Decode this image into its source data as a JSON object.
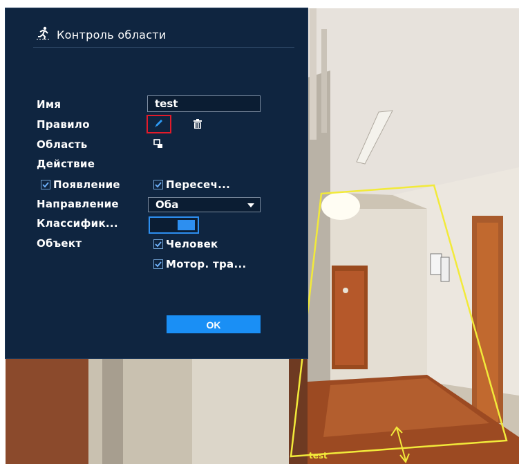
{
  "dialog": {
    "title": "Контроль области",
    "name_label": "Имя",
    "name_value": "test",
    "rule_label": "Правило",
    "area_label": "Область",
    "action_label": "Действие",
    "actions": [
      {
        "label": "Появление",
        "checked": true
      },
      {
        "label": "Пересеч...",
        "checked": true
      }
    ],
    "direction_label": "Направление",
    "direction_value": "Оба",
    "classification_label": "Классифик...",
    "classification_on": true,
    "object_label": "Объект",
    "objects": [
      {
        "label": "Человек",
        "checked": true
      },
      {
        "label": "Мотор. тра...",
        "checked": true
      }
    ],
    "ok_label": "OK"
  },
  "icons": {
    "title": "running-person-icon",
    "rule_edit": "pencil-icon",
    "rule_delete": "trash-icon",
    "area": "area-draw-icon"
  },
  "video": {
    "zone_label": "test"
  },
  "colors": {
    "dialog_bg": "#0f2540",
    "accent": "#1a8ff5",
    "highlight_border": "#e21b2a",
    "zone_line": "#f2ea3a"
  }
}
